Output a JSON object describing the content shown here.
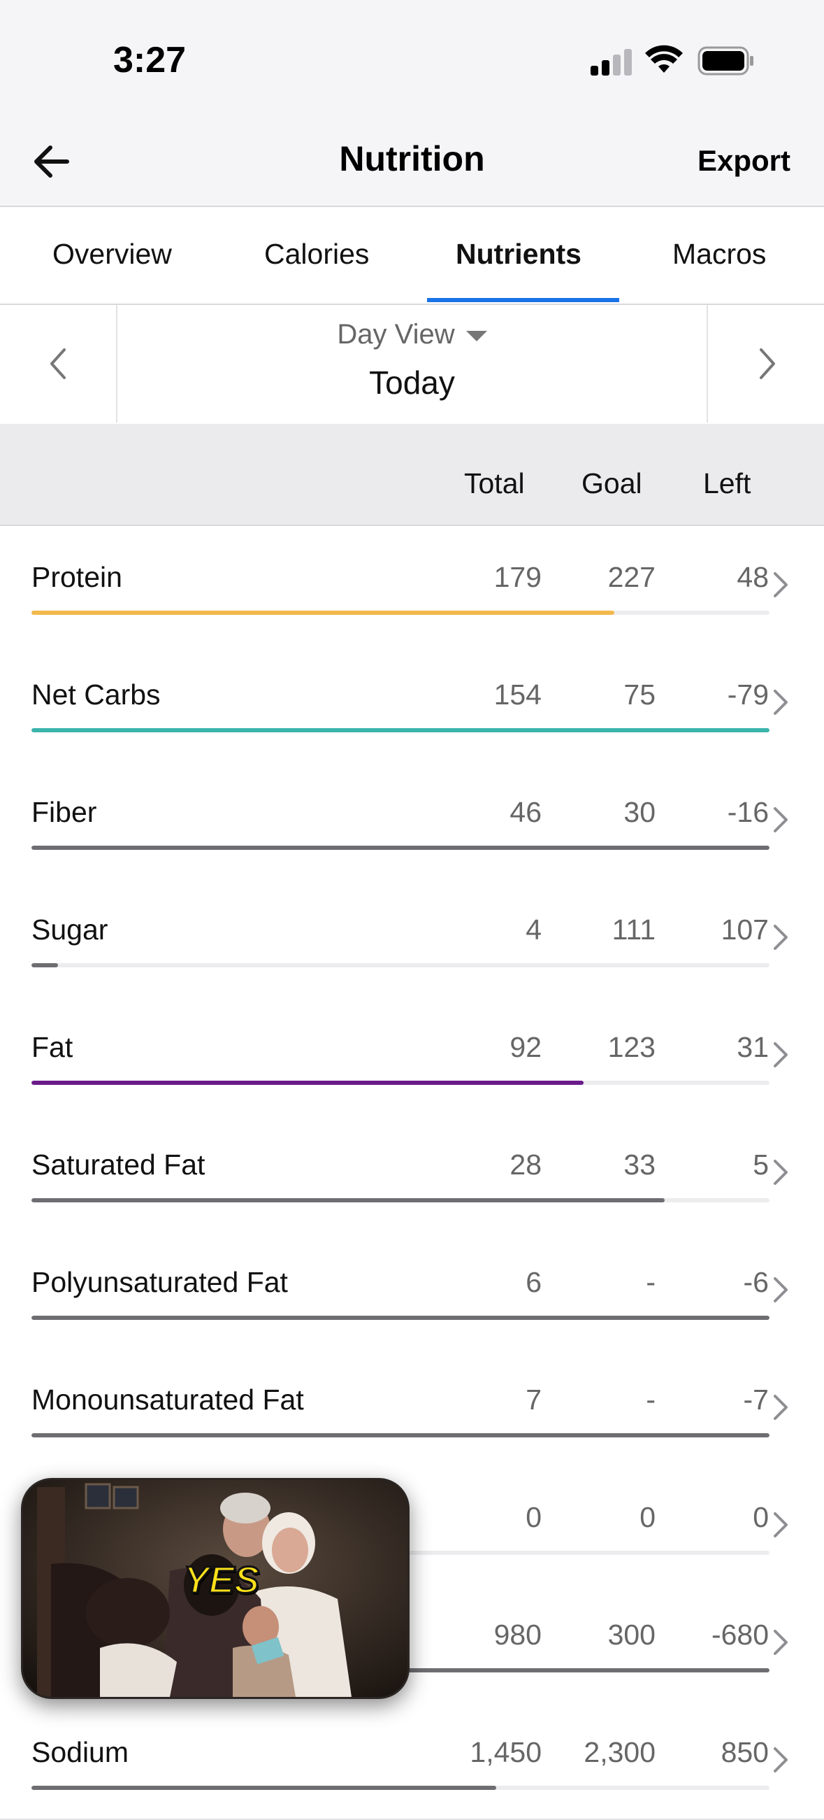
{
  "status_bar": {
    "time": "3:27"
  },
  "nav": {
    "title": "Nutrition",
    "export_label": "Export"
  },
  "tabs": [
    {
      "label": "Overview",
      "active": false
    },
    {
      "label": "Calories",
      "active": false
    },
    {
      "label": "Nutrients",
      "active": true
    },
    {
      "label": "Macros",
      "active": false
    }
  ],
  "date_nav": {
    "view_label": "Day View",
    "date_label": "Today"
  },
  "table": {
    "headers": {
      "total": "Total",
      "goal": "Goal",
      "left": "Left"
    },
    "rows": [
      {
        "name": "Protein",
        "total": "179",
        "goal": "227",
        "left": "48",
        "progress": 0.79,
        "color": "#f2b84b"
      },
      {
        "name": "Net Carbs",
        "total": "154",
        "goal": "75",
        "left": "-79",
        "progress": 1.0,
        "color": "#3bb5ac"
      },
      {
        "name": "Fiber",
        "total": "46",
        "goal": "30",
        "left": "-16",
        "progress": 1.0,
        "color": "#6e6e72"
      },
      {
        "name": "Sugar",
        "total": "4",
        "goal": "111",
        "left": "107",
        "progress": 0.036,
        "color": "#6e6e72"
      },
      {
        "name": "Fat",
        "total": "92",
        "goal": "123",
        "left": "31",
        "progress": 0.748,
        "color": "#6a1b8a"
      },
      {
        "name": "Saturated Fat",
        "total": "28",
        "goal": "33",
        "left": "5",
        "progress": 0.858,
        "color": "#6e6e72"
      },
      {
        "name": "Polyunsaturated Fat",
        "total": "6",
        "goal": "-",
        "left": "-6",
        "progress": 1.0,
        "color": "#6e6e72"
      },
      {
        "name": "Monounsaturated Fat",
        "total": "7",
        "goal": "-",
        "left": "-7",
        "progress": 1.0,
        "color": "#6e6e72"
      },
      {
        "name": "",
        "total": "0",
        "goal": "0",
        "left": "0",
        "progress": 0.0,
        "color": "#6e6e72"
      },
      {
        "name": "",
        "total": "980",
        "goal": "300",
        "left": "-680",
        "progress": 1.0,
        "color": "#6e6e72"
      },
      {
        "name": "Sodium",
        "total": "1,450",
        "goal": "2,300",
        "left": "850",
        "progress": 0.63,
        "color": "#6e6e72"
      }
    ]
  },
  "pip_video": {
    "caption": "YES"
  }
}
